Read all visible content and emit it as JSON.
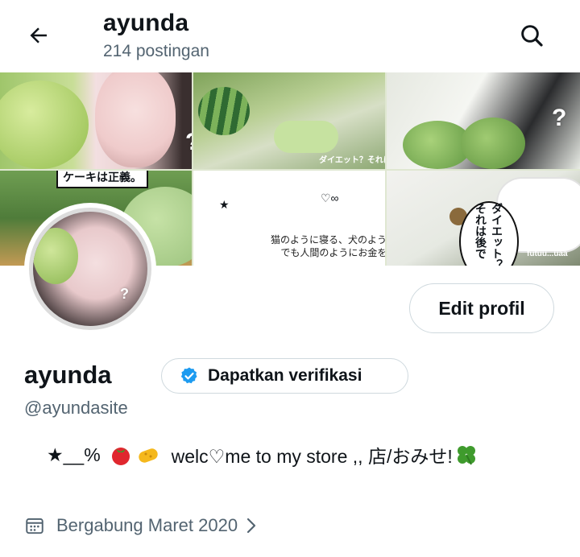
{
  "header": {
    "title": "ayunda",
    "post_count": "214 postingan",
    "back_icon": "arrow-left-icon",
    "search_icon": "search-icon"
  },
  "banner": {
    "caption_cake": "ケーキは正義。",
    "caption_diet_small": "ダイエット？それは後で",
    "caption_bubble": "ダイエット？それは後で",
    "caption_cat_line1": "猫のように寝る、犬のように走る、",
    "caption_cat_line2": "でも人間のようにお金を使う。",
    "caption_credit": "futuu...uaa",
    "star": "★",
    "heart": "♡∞",
    "qmark": "?"
  },
  "profile": {
    "edit_button": "Edit profil",
    "display_name": "ayunda",
    "verify_button": "Dapatkan verifikasi",
    "handle": "@ayundasite",
    "bio_prefix": "★__%",
    "bio_text": "welc♡me to my store ,, 店/おみせ!",
    "joined": "Bergabung Maret 2020",
    "verify_color": "#1d9bf0"
  }
}
